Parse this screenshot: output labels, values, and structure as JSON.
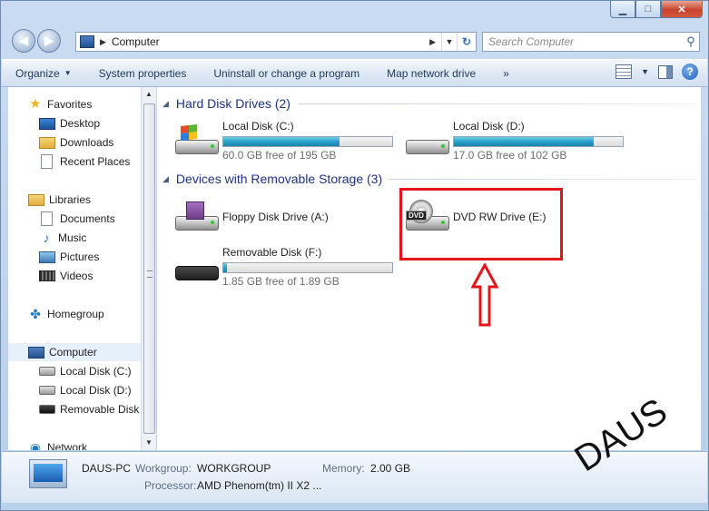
{
  "address": {
    "path": "Computer",
    "search_placeholder": "Search Computer"
  },
  "toolbar": {
    "organize": "Organize",
    "system_properties": "System properties",
    "uninstall": "Uninstall or change a program",
    "map_drive": "Map network drive",
    "more": "»"
  },
  "nav": {
    "favorites": "Favorites",
    "desktop": "Desktop",
    "downloads": "Downloads",
    "recent": "Recent Places",
    "libraries": "Libraries",
    "documents": "Documents",
    "music": "Music",
    "pictures": "Pictures",
    "videos": "Videos",
    "homegroup": "Homegroup",
    "computer": "Computer",
    "disk_c": "Local Disk (C:)",
    "disk_d": "Local Disk (D:)",
    "removable": "Removable Disk (",
    "network": "Network"
  },
  "groups": {
    "hard_disks": "Hard Disk Drives (2)",
    "removable": "Devices with Removable Storage (3)"
  },
  "drives": {
    "c": {
      "name": "Local Disk (C:)",
      "free": "60.0 GB free of 195 GB",
      "used_fraction": 0.69
    },
    "d": {
      "name": "Local Disk (D:)",
      "free": "17.0 GB free of 102 GB",
      "used_fraction": 0.83
    },
    "floppy": {
      "name": "Floppy Disk Drive (A:)"
    },
    "dvd": {
      "name": "DVD RW Drive (E:)",
      "label": "DVD"
    },
    "f": {
      "name": "Removable Disk (F:)",
      "free": "1.85 GB free of 1.89 GB",
      "used_fraction": 0.02
    }
  },
  "details": {
    "pc_name": "DAUS-PC",
    "workgroup_label": "Workgroup:",
    "workgroup": "WORKGROUP",
    "memory_label": "Memory:",
    "memory": "2.00 GB",
    "processor_label": "Processor:",
    "processor": "AMD Phenom(tm) II X2 ..."
  },
  "watermark": "DAUS",
  "colors": {
    "highlight": "#e3151b",
    "bar_fill": "#2aa0c7",
    "group_heading": "#1e3287"
  }
}
